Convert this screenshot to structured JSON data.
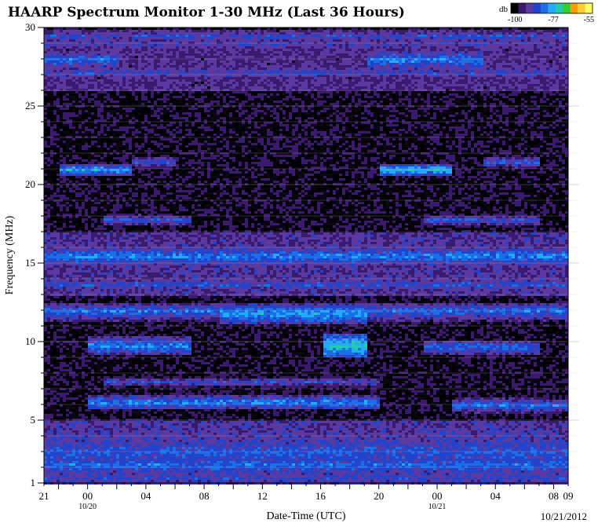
{
  "chart_data": {
    "type": "heatmap",
    "title": "HAARP Spectrum Monitor 1-30 MHz (Last 36 Hours)",
    "xlabel": "Date-Time (UTC)",
    "ylabel": "Frequency (MHz)",
    "ylim": [
      1,
      30
    ],
    "xlim_hours": [
      0,
      36
    ],
    "x_tick_labels": [
      "21",
      "00",
      "04",
      "08",
      "12",
      "16",
      "20",
      "00",
      "04",
      "08",
      "09"
    ],
    "x_tick_hours": [
      0,
      3,
      7,
      11,
      15,
      19,
      23,
      27,
      31,
      35,
      36
    ],
    "x_date_labels": [
      {
        "text": "10/20",
        "hour": 3
      },
      {
        "text": "10/21",
        "hour": 27
      }
    ],
    "y_tick_labels": [
      "1",
      "5",
      "10",
      "15",
      "20",
      "25",
      "30"
    ],
    "y_tick_values": [
      1,
      5,
      10,
      15,
      20,
      25,
      30
    ],
    "grid": true,
    "colorbar": {
      "label": "db",
      "tick_labels": [
        "-100",
        "-77",
        "-55"
      ],
      "range": [
        -100,
        -55
      ],
      "colors": [
        "#000000",
        "#3a1a6e",
        "#5a3aa0",
        "#2244cc",
        "#1a6ee8",
        "#22aaff",
        "#22ccaa",
        "#33cc33",
        "#ff9900",
        "#ffcc33",
        "#ffff66"
      ]
    },
    "bands": [
      {
        "freq": 29.5,
        "width": 0.3,
        "level": -85,
        "start": 0,
        "end": 36
      },
      {
        "freq": 29.0,
        "width": 0.4,
        "level": -88,
        "start": 0,
        "end": 36
      },
      {
        "freq": 28.0,
        "width": 0.5,
        "level": -82,
        "start": 0,
        "end": 5
      },
      {
        "freq": 28.0,
        "width": 0.5,
        "level": -80,
        "start": 22,
        "end": 30
      },
      {
        "freq": 27.2,
        "width": 0.4,
        "level": -86,
        "start": 0,
        "end": 36
      },
      {
        "freq": 21.5,
        "width": 0.3,
        "level": -84,
        "start": 6,
        "end": 9
      },
      {
        "freq": 21.0,
        "width": 0.3,
        "level": -78,
        "start": 1,
        "end": 6
      },
      {
        "freq": 21.0,
        "width": 0.3,
        "level": -76,
        "start": 23,
        "end": 28
      },
      {
        "freq": 21.5,
        "width": 0.3,
        "level": -84,
        "start": 30,
        "end": 34
      },
      {
        "freq": 17.8,
        "width": 0.3,
        "level": -84,
        "start": 4,
        "end": 10
      },
      {
        "freq": 17.8,
        "width": 0.3,
        "level": -84,
        "start": 26,
        "end": 34
      },
      {
        "freq": 15.5,
        "width": 0.5,
        "level": -80,
        "start": 0,
        "end": 36
      },
      {
        "freq": 13.7,
        "width": 0.3,
        "level": -84,
        "start": 0,
        "end": 36
      },
      {
        "freq": 12.0,
        "width": 0.5,
        "level": -82,
        "start": 0,
        "end": 36
      },
      {
        "freq": 11.8,
        "width": 0.5,
        "level": -78,
        "start": 12,
        "end": 22
      },
      {
        "freq": 9.8,
        "width": 0.5,
        "level": -80,
        "start": 3,
        "end": 10
      },
      {
        "freq": 9.8,
        "width": 0.6,
        "level": -74,
        "start": 19,
        "end": 22
      },
      {
        "freq": 9.7,
        "width": 0.4,
        "level": -82,
        "start": 26,
        "end": 34
      },
      {
        "freq": 7.5,
        "width": 0.3,
        "level": -86,
        "start": 4,
        "end": 23
      },
      {
        "freq": 6.2,
        "width": 0.4,
        "level": -80,
        "start": 3,
        "end": 23
      },
      {
        "freq": 6.0,
        "width": 0.4,
        "level": -82,
        "start": 28,
        "end": 36
      },
      {
        "freq": 3.0,
        "width": 1.2,
        "level": -84,
        "start": 0,
        "end": 36
      },
      {
        "freq": 2.2,
        "width": 0.6,
        "level": -82,
        "start": 0,
        "end": 36
      },
      {
        "freq": 1.4,
        "width": 0.4,
        "level": -86,
        "start": 0,
        "end": 36
      }
    ]
  },
  "footer_date": "10/21/2012"
}
